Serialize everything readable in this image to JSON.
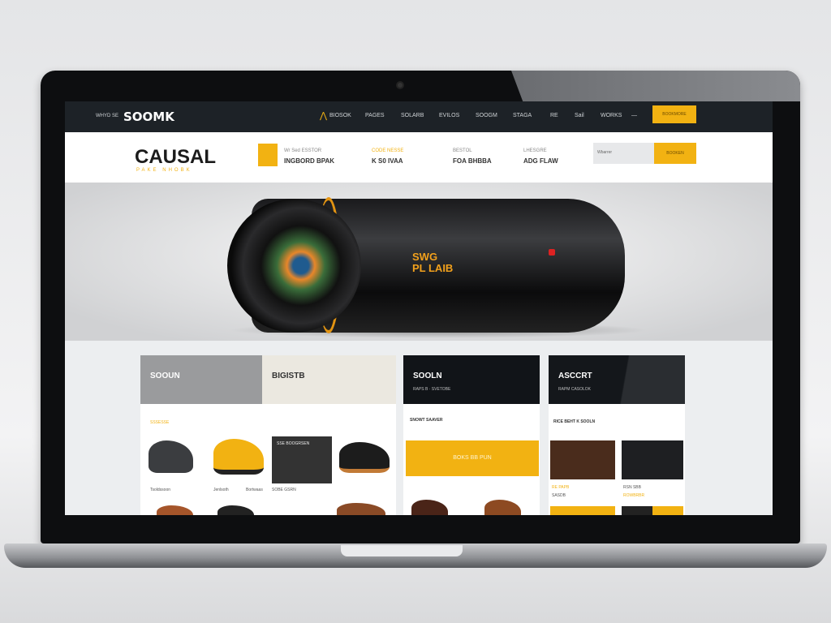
{
  "nav": {
    "tagline": "WHYD SE",
    "logo": "SOOMK",
    "items": [
      "BIOSOK",
      "PAGES",
      "SOLARB",
      "EVILOS",
      "SOOGM",
      "STAGA",
      "RE",
      "Sail",
      "WORKS",
      "—"
    ],
    "cta": "BOOKMORE"
  },
  "header": {
    "brand": "CAUSAL",
    "brand_sub": "PAKE NHOBK",
    "info": [
      {
        "top": "Wr Sed  ESSTOR",
        "bot": "INGBORD BPAK"
      },
      {
        "top": "CODE NESSE",
        "bot": "K S0 IVAA"
      },
      {
        "top": "BESTOL",
        "bot": "FOA BHBBA"
      },
      {
        "top": "LHESGRE",
        "bot": "ADG FLAW"
      }
    ],
    "search_placeholder": "Wbarrer",
    "search_button": "BOOKEN"
  },
  "hero": {
    "product_text": "SWG",
    "product_text2": "PL LAIB"
  },
  "cards": [
    {
      "title": "SOOUN",
      "sub": "",
      "title2": "BIGISTB",
      "row": "SSSESSE",
      "promo": "SSE BOOGRSEN",
      "labels": [
        "Tsoldssoon",
        "Jenlsoth",
        "Bortwaas",
        "SOBE GSRN"
      ]
    },
    {
      "title": "SOOLN",
      "sub": "RAPS B · SVETOBE",
      "row": "SNOWT SAAVER",
      "button": "BOKS BB PUN"
    },
    {
      "title": "ASCCRT",
      "sub": "RAPM CASOLOK",
      "row": "RICE BEHT K SOOLN",
      "labels": [
        "RE PAPB",
        "SASDB",
        "RSN SBB",
        "ROWBRBR"
      ]
    }
  ],
  "colors": {
    "accent": "#f2b212",
    "nav": "#1d2227"
  }
}
